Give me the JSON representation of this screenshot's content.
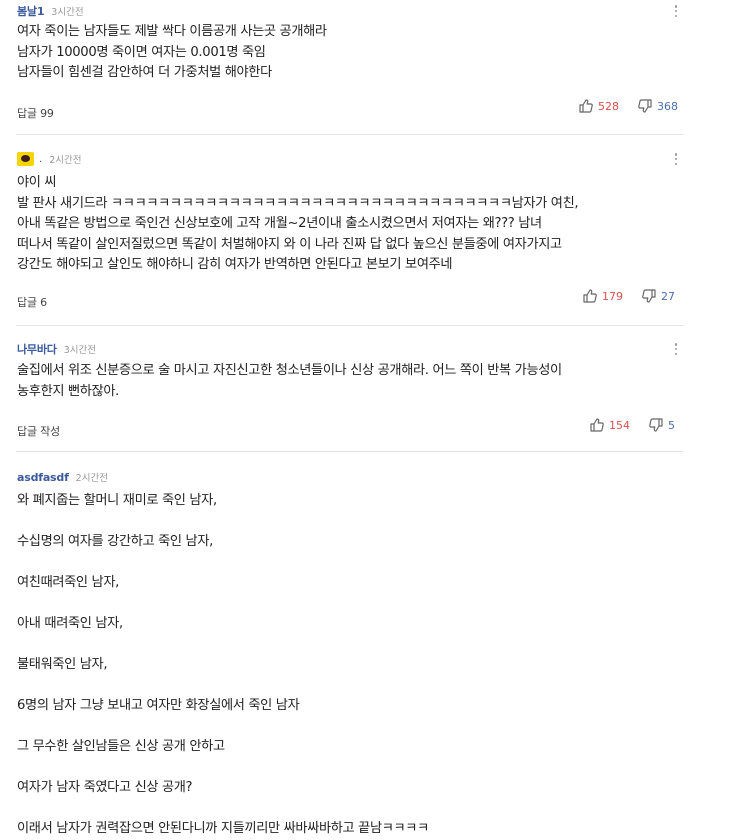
{
  "comments": [
    {
      "author": "봄날1",
      "time": "3시간전",
      "lines": [
        "여자 죽이는 남자들도 제발 싹다 이름공개 사는곳 공개해라",
        "남자가 10000명 죽이면 여자는 0.001명 죽임",
        "남자들이 힘센걸 감안하여 더 가중처벌 해야한다"
      ],
      "reply_label": "답글 99",
      "likes": "528",
      "dislikes": "368"
    },
    {
      "author": ".",
      "author_icon": "kakao-icon",
      "time": "2시간전",
      "lines": [
        "야이 씨",
        "발 판사 새기드라 ㅋㅋㅋㅋㅋㅋㅋㅋㅋㅋㅋㅋㅋㅋㅋㅋㅋㅋㅋㅋㅋㅋㅋㅋㅋㅋㅋㅋㅋㅋㅋㅋㅋㅋ남자가 여친,",
        "아내 똑같은 방법으로 죽인건 신상보호에 고작 개월~2년이내 출소시켰으면서 저여자는 왜??? 남녀",
        "떠나서 똑같이 살인저질렀으면 똑같이 처벌해야지 와 이 나라 진짜 답 없다 높으신 분들중에 여자가지고",
        "강간도 해야되고 살인도 해야하니 감히 여자가 반역하면 안된다고 본보기 보여주네"
      ],
      "reply_label": "답글 6",
      "likes": "179",
      "dislikes": "27"
    },
    {
      "author": "나무바다",
      "time": "3시간전",
      "lines": [
        "술집에서 위조 신분증으로 술 마시고 자진신고한 청소년들이나 신상 공개해라. 어느 쪽이 반복 가능성이",
        "농후한지 뻔하잖아."
      ],
      "reply_label": "답글 작성",
      "likes": "154",
      "dislikes": "5"
    },
    {
      "author": "asdfasdf",
      "time": "2시간전",
      "lines": [
        "와 폐지줍는 할머니 재미로 죽인 남자,",
        "",
        "수십명의 여자를 강간하고 죽인 남자,",
        "",
        "여친때려죽인 남자,",
        "",
        "아내 때려죽인 남자,",
        "",
        "불태워죽인 남자,",
        "",
        "6명의 남자 그냥 보내고 여자만 화장실에서 죽인 남자",
        "",
        "그 무수한 살인남들은 신상 공개 안하고",
        "",
        "여자가 남자 죽였다고 신상 공개?",
        "",
        "이래서 남자가 권력잡으면 안된다니까 지들끼리만 싸바싸바하고 끝남ㅋㅋㅋㅋ"
      ]
    }
  ],
  "colors": {
    "author": "#3a5a9c",
    "like": "#d9534f",
    "dislike": "#4a6fb0",
    "divider": "#e4e4e4"
  }
}
